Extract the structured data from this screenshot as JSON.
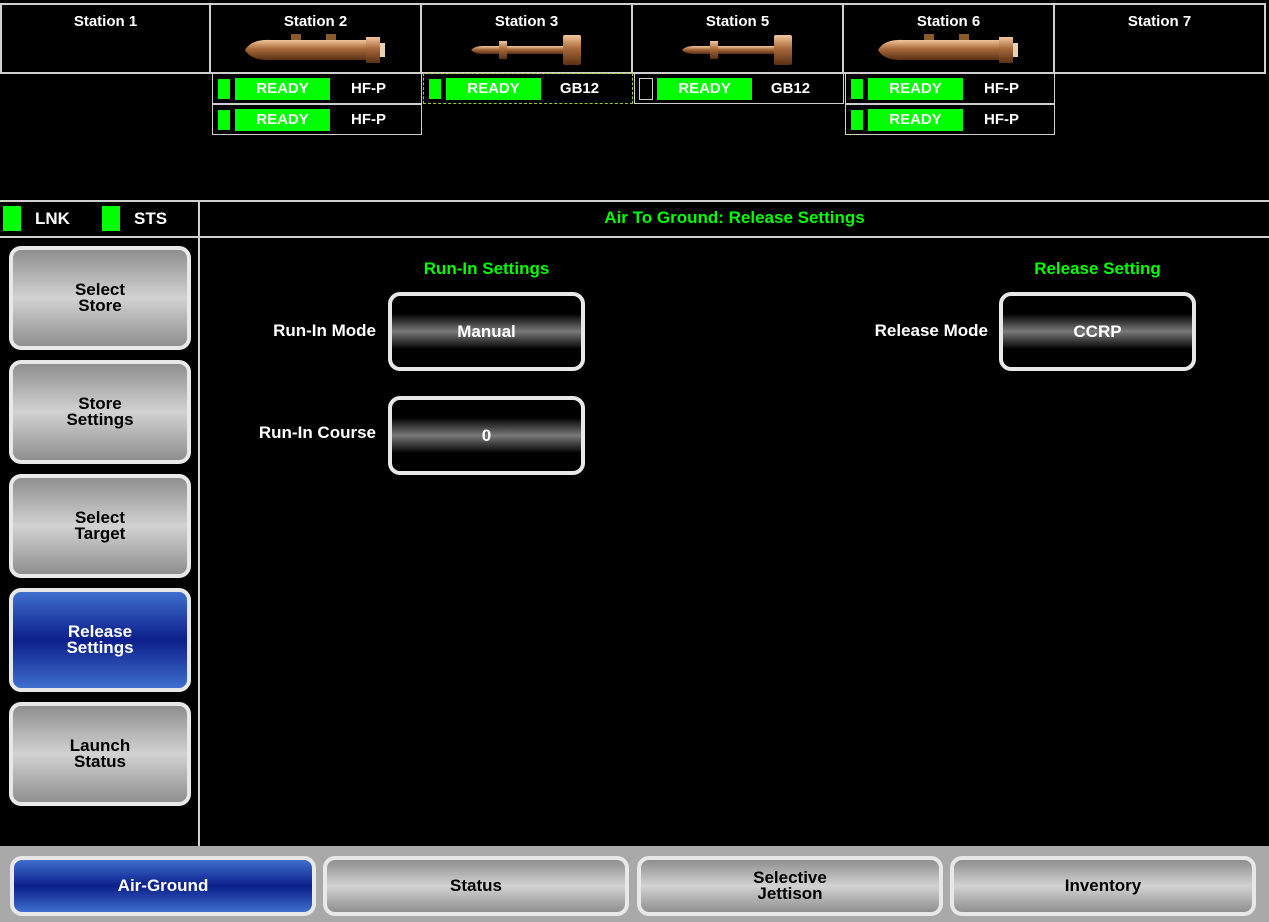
{
  "stations": [
    {
      "name": "Station 1",
      "store": "none"
    },
    {
      "name": "Station 2",
      "store": "large-bomb-icon"
    },
    {
      "name": "Station 3",
      "store": "guided-bomb-icon"
    },
    {
      "name": "Station 5",
      "store": "guided-bomb-icon"
    },
    {
      "name": "Station 6",
      "store": "large-bomb-icon"
    },
    {
      "name": "Station 7",
      "store": "none"
    }
  ],
  "store_rows": [
    {
      "station": "Station 2",
      "status": "READY",
      "type": "HF-P",
      "indicator_on": true
    },
    {
      "station": "Station 2",
      "status": "READY",
      "type": "HF-P",
      "indicator_on": true
    },
    {
      "station": "Station 3",
      "status": "READY",
      "type": "GB12",
      "indicator_on": true
    },
    {
      "station": "Station 5",
      "status": "READY",
      "type": "GB12",
      "indicator_on": false
    },
    {
      "station": "Station 6",
      "status": "READY",
      "type": "HF-P",
      "indicator_on": true
    },
    {
      "station": "Station 6",
      "status": "READY",
      "type": "HF-P",
      "indicator_on": true
    }
  ],
  "indicators": {
    "lnk": "LNK",
    "sts": "STS"
  },
  "page_title": "Air To Ground: Release Settings",
  "side_menu": [
    {
      "label": "Select\nStore",
      "active": false
    },
    {
      "label": "Store\nSettings",
      "active": false
    },
    {
      "label": "Select\nTarget",
      "active": false
    },
    {
      "label": "Release\nSettings",
      "active": true
    },
    {
      "label": "Launch\nStatus",
      "active": false
    }
  ],
  "run_in": {
    "heading": "Run-In Settings",
    "mode_label": "Run-In Mode",
    "mode_value": "Manual",
    "course_label": "Run-In Course",
    "course_value": "0"
  },
  "release": {
    "heading": "Release Setting",
    "mode_label": "Release Mode",
    "mode_value": "CCRP"
  },
  "bottom_tabs": [
    {
      "label": "Air-Ground",
      "active": true
    },
    {
      "label": "Status",
      "active": false
    },
    {
      "label": "Selective\nJettison",
      "active": false
    },
    {
      "label": "Inventory",
      "active": false
    }
  ],
  "colors": {
    "accent": "#00ff00",
    "active_button": "#0b1f8a",
    "frame": "#cfcfcf"
  }
}
